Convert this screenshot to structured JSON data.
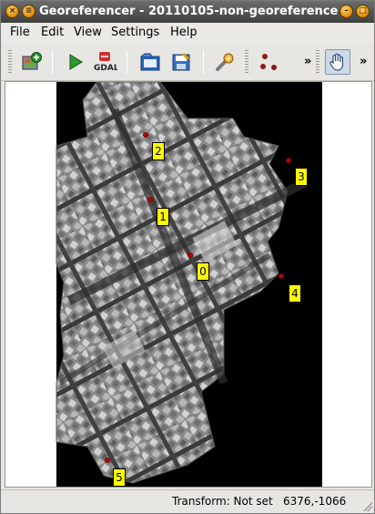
{
  "window": {
    "title": "Georeferencer - 20110105-non-georeferenced"
  },
  "titlebar_buttons": [
    {
      "name": "close",
      "glyph": "×"
    },
    {
      "name": "menu",
      "glyph": "≡"
    },
    {
      "name": "minimize",
      "glyph": "–"
    }
  ],
  "menubar": {
    "items": [
      "File",
      "Edit",
      "View",
      "Settings",
      "Help"
    ]
  },
  "toolbar": {
    "tools": [
      {
        "id": "open-raster",
        "icon": "open-raster-icon"
      },
      {
        "id": "start-georeferencing",
        "icon": "play-icon"
      },
      {
        "id": "generate-gdal-script",
        "icon": "gdal-script-icon",
        "text": "GDAL"
      },
      {
        "id": "load-gcp-points",
        "icon": "load-gcp-icon"
      },
      {
        "id": "save-gcp-points",
        "icon": "save-gcp-icon"
      },
      {
        "id": "transformation-settings",
        "icon": "wrench-icon"
      },
      {
        "id": "add-point",
        "icon": "add-point-icon"
      },
      {
        "id": "pan",
        "icon": "hand-pan-icon",
        "active": true
      }
    ],
    "overflow_glyph": "»"
  },
  "gcp_points": [
    {
      "label": "0"
    },
    {
      "label": "1"
    },
    {
      "label": "2"
    },
    {
      "label": "3"
    },
    {
      "label": "4"
    },
    {
      "label": "5"
    }
  ],
  "statusbar": {
    "transform": "Transform: Not set",
    "coords": "6376,-1066"
  },
  "colors": {
    "gcp_label_bg": "#ffff00",
    "gcp_point": "#c00000",
    "titlebar": "#4a4a4a"
  }
}
